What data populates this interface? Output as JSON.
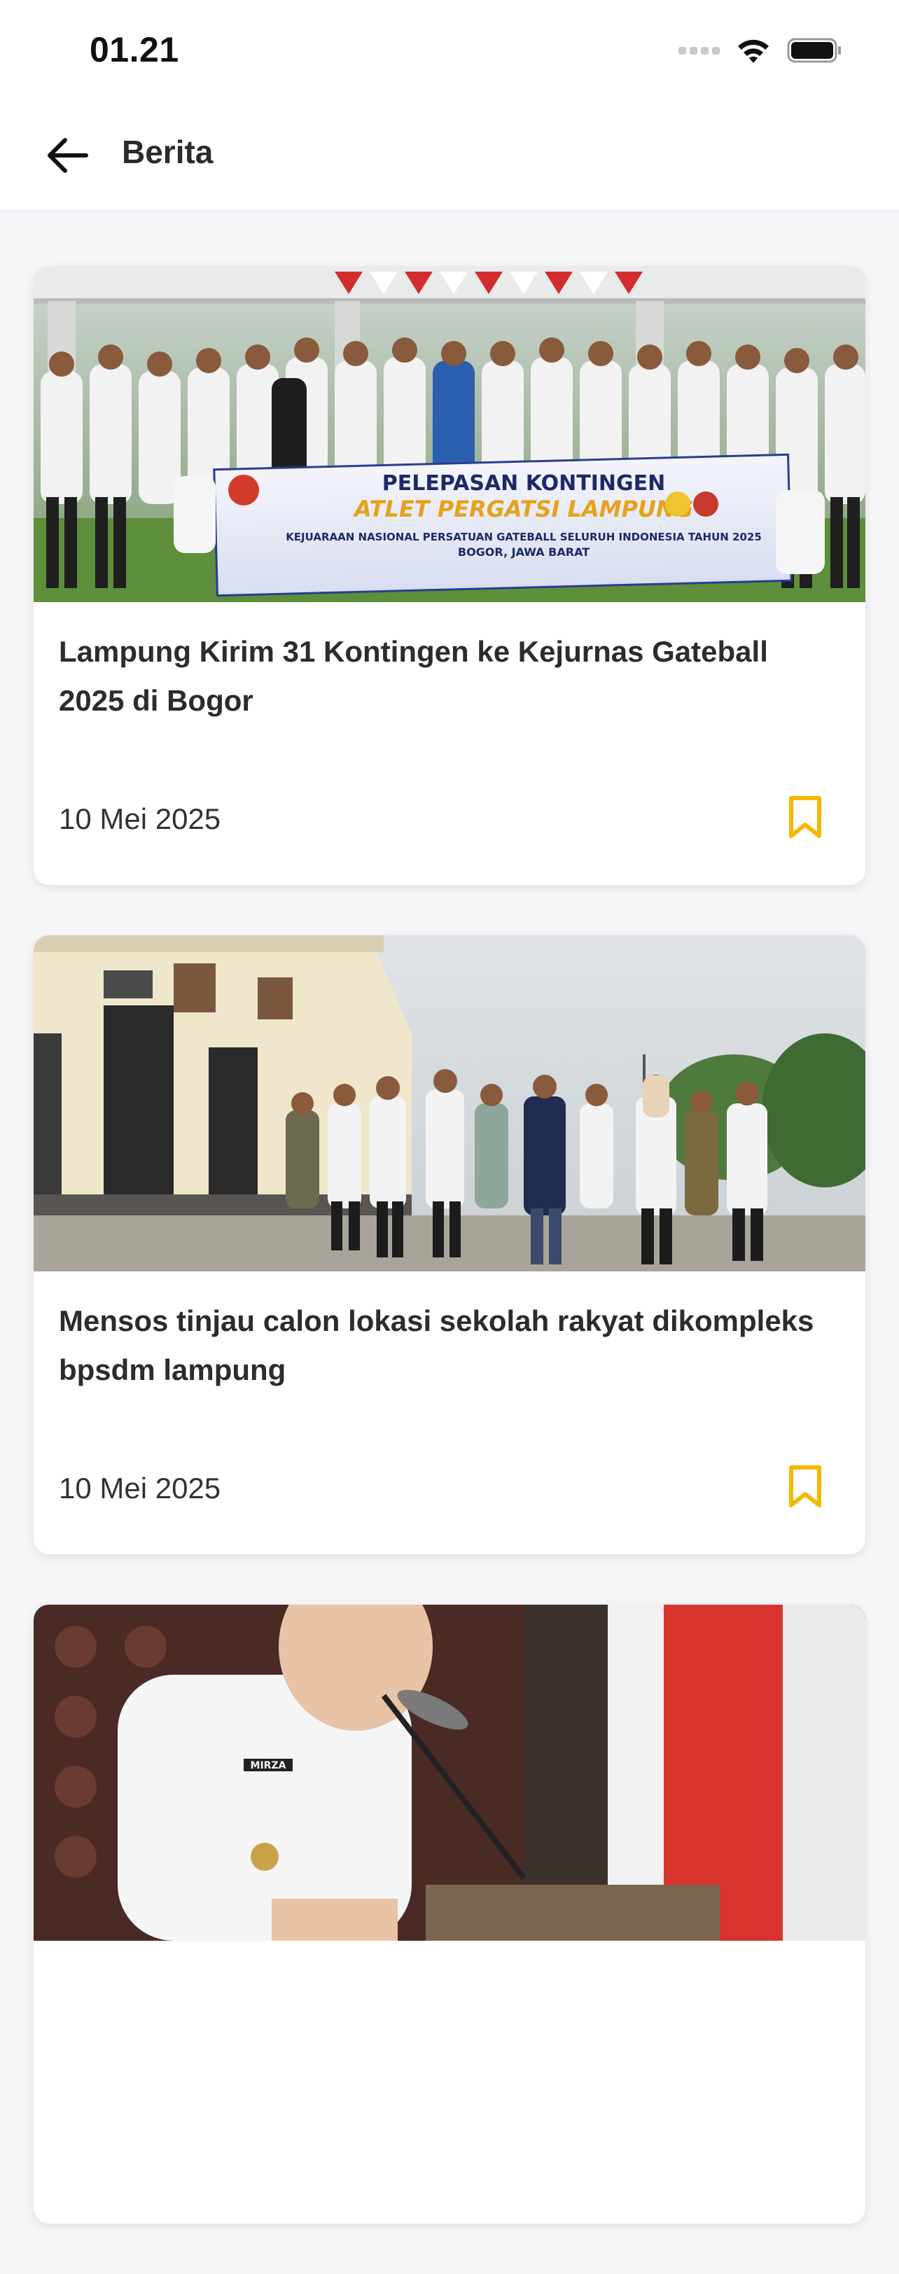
{
  "status_bar": {
    "time": "01.21"
  },
  "header": {
    "title": "Berita",
    "back_icon": "arrow-left-icon"
  },
  "colors": {
    "bookmark_accent": "#f5b800",
    "title_text": "#2c2c2c",
    "header_divider": "#eef1f6"
  },
  "news": [
    {
      "title": "Lampung Kirim 31 Kontingen ke Kejurnas Gateball 2025 di Bogor",
      "date": "10 Mei 2025",
      "bookmark_icon": "bookmark-icon",
      "photo_banner": {
        "line1": "PELEPASAN KONTINGEN",
        "line2": "ATLET PERGATSI LAMPUNG",
        "line3": "KEJUARAAN NASIONAL PERSATUAN GATEBALL SELURUH INDONESIA TAHUN 2025",
        "line4": "BOGOR, JAWA BARAT"
      }
    },
    {
      "title": "Mensos tinjau calon lokasi sekolah rakyat dikompleks bpsdm lampung",
      "date": "10 Mei 2025",
      "bookmark_icon": "bookmark-icon"
    },
    {
      "photo_name_tag": "MIRZA"
    }
  ]
}
